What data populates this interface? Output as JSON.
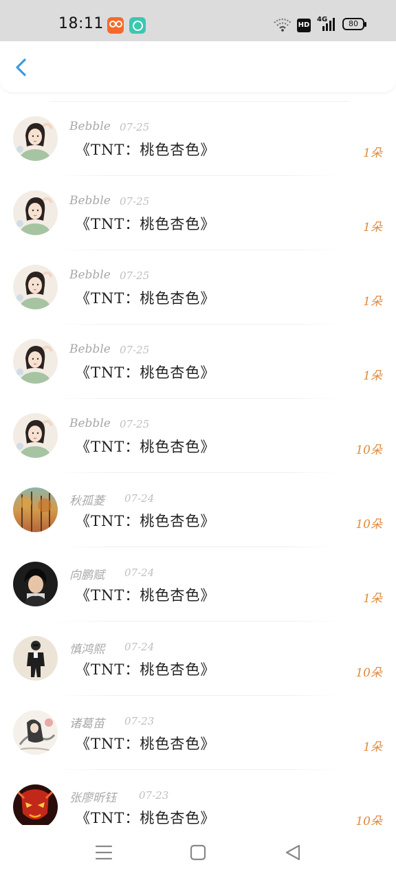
{
  "status_bar": {
    "time": "18:11",
    "hd": "HD",
    "network": "4G",
    "battery": "80"
  },
  "colors": {
    "accent_blue": "#3a9be0",
    "amount_orange": "#e08a3c"
  },
  "header": {
    "back_icon": "chevron-left-icon"
  },
  "gifts": [
    {
      "user": "Bebble",
      "date": "07-25",
      "gift": "《TNT：桃色杏色》",
      "amount": "1朵",
      "avatar": "girl-illustration"
    },
    {
      "user": "Bebble",
      "date": "07-25",
      "gift": "《TNT：桃色杏色》",
      "amount": "1朵",
      "avatar": "girl-illustration"
    },
    {
      "user": "Bebble",
      "date": "07-25",
      "gift": "《TNT：桃色杏色》",
      "amount": "1朵",
      "avatar": "girl-illustration"
    },
    {
      "user": "Bebble",
      "date": "07-25",
      "gift": "《TNT：桃色杏色》",
      "amount": "1朵",
      "avatar": "girl-illustration"
    },
    {
      "user": "Bebble",
      "date": "07-25",
      "gift": "《TNT：桃色杏色》",
      "amount": "10朵",
      "avatar": "girl-illustration"
    },
    {
      "user": "秋孤菱",
      "date": "07-24",
      "gift": "《TNT：桃色杏色》",
      "amount": "10朵",
      "avatar": "autumn-forest"
    },
    {
      "user": "向鹏赋",
      "date": "07-24",
      "gift": "《TNT：桃色杏色》",
      "amount": "1朵",
      "avatar": "person-photo"
    },
    {
      "user": "慎鸿熙",
      "date": "07-24",
      "gift": "《TNT：桃色杏色》",
      "amount": "10朵",
      "avatar": "suited-man"
    },
    {
      "user": "诸葛苗",
      "date": "07-23",
      "gift": "《TNT：桃色杏色》",
      "amount": "1朵",
      "avatar": "ink-painting"
    },
    {
      "user": "张廖昕钰",
      "date": "07-23",
      "gift": "《TNT：桃色杏色》",
      "amount": "10朵",
      "avatar": "red-mask"
    }
  ],
  "nav": {
    "menu_icon": "menu-icon",
    "home_icon": "home-square-icon",
    "back_icon": "back-triangle-icon"
  }
}
